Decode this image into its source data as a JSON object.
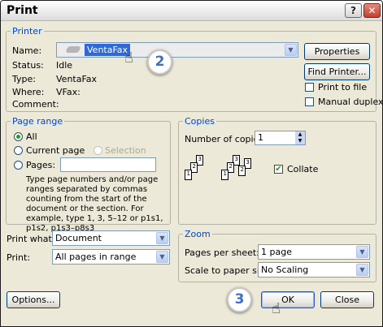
{
  "window": {
    "title": "Print"
  },
  "printer": {
    "legend": "Printer",
    "name_label": "Name:",
    "name_value": "VentaFax",
    "status_label": "Status:",
    "status_value": "Idle",
    "type_label": "Type:",
    "type_value": "VentaFax",
    "where_label": "Where:",
    "where_value": "VFax:",
    "comment_label": "Comment:",
    "comment_value": "",
    "properties_button": "Properties",
    "find_printer_button": "Find Printer...",
    "print_to_file_label": "Print to file",
    "print_to_file_checked": false,
    "manual_duplex_label": "Manual duplex",
    "manual_duplex_checked": false
  },
  "page_range": {
    "legend": "Page range",
    "all_label": "All",
    "current_page_label": "Current page",
    "selection_label": "Selection",
    "pages_label": "Pages:",
    "pages_value": "",
    "selected": "All",
    "help_text": "Type page numbers and/or page ranges separated by commas counting from the start of the document or the section. For example, type 1, 3, 5–12 or p1s1, p1s2, p1s3–p8s3"
  },
  "copies": {
    "legend": "Copies",
    "number_label": "Number of copies:",
    "number_value": "1",
    "collate_label": "Collate",
    "collate_checked": true
  },
  "print_what": {
    "label": "Print what:",
    "value": "Document"
  },
  "print": {
    "label": "Print:",
    "value": "All pages in range"
  },
  "zoom": {
    "legend": "Zoom",
    "pages_per_sheet_label": "Pages per sheet:",
    "pages_per_sheet_value": "1 page",
    "scale_label": "Scale to paper size:",
    "scale_value": "No Scaling"
  },
  "buttons": {
    "options": "Options...",
    "ok": "OK",
    "close": "Close"
  },
  "callouts": {
    "first": "2",
    "second": "3"
  }
}
